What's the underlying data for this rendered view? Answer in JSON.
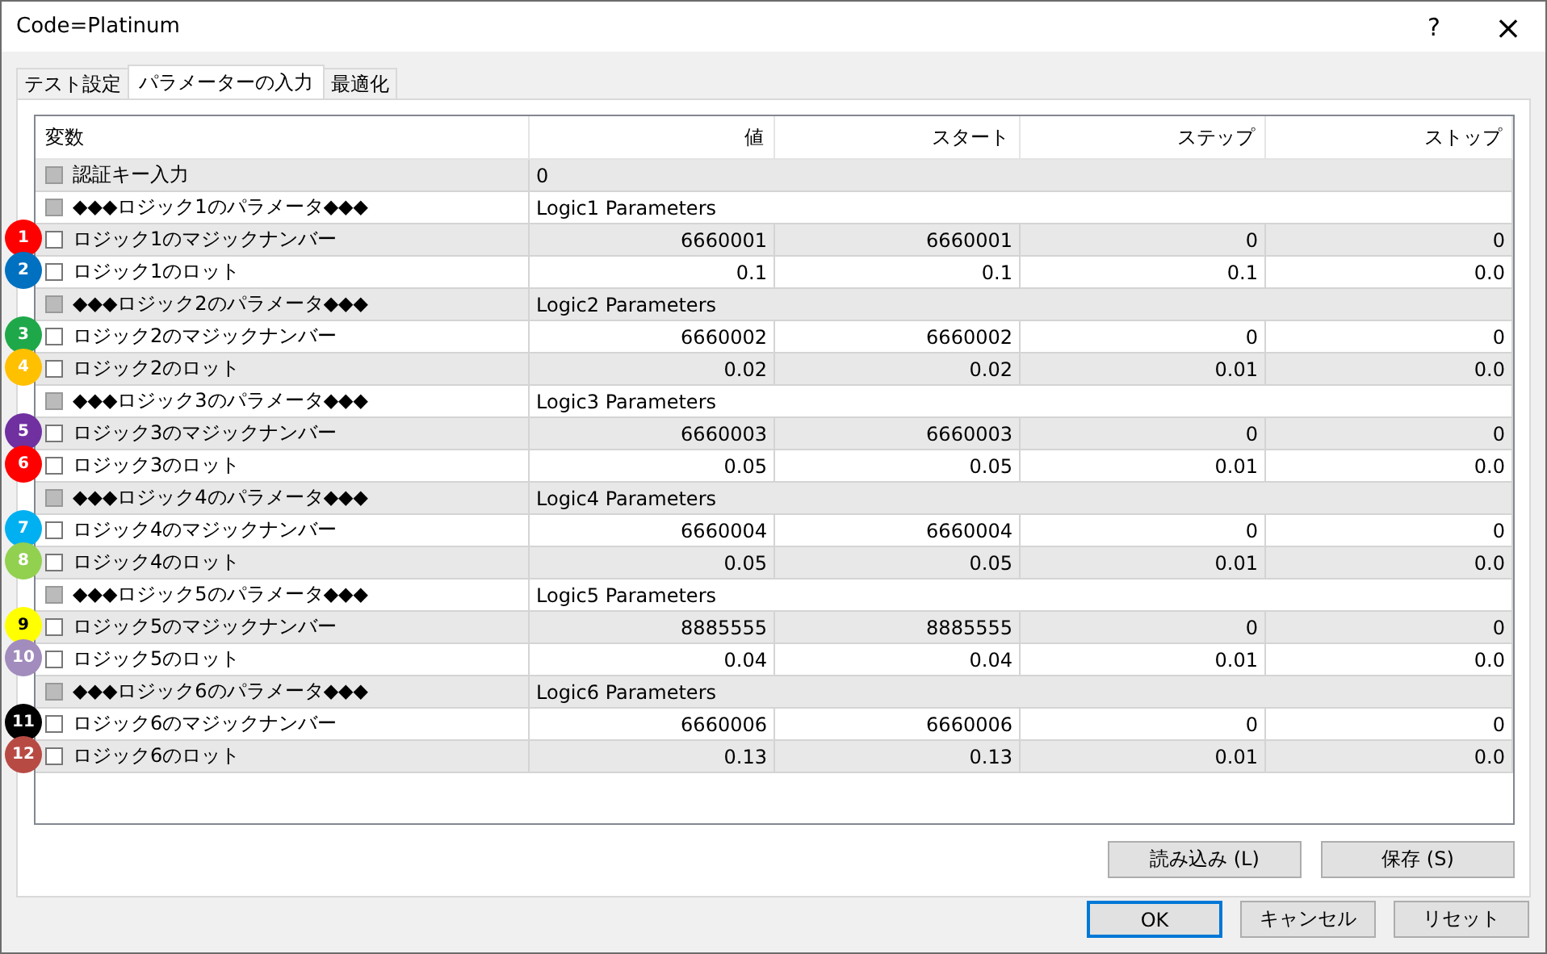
{
  "window": {
    "title": "Code=Platinum",
    "help": "?",
    "close": "×"
  },
  "tabs": [
    {
      "label": "テスト設定",
      "selected": false
    },
    {
      "label": "パラメーターの入力",
      "selected": true
    },
    {
      "label": "最適化",
      "selected": false
    }
  ],
  "table": {
    "columns": [
      "変数",
      "値",
      "スタート",
      "ステップ",
      "ストップ"
    ],
    "rows": [
      {
        "kind": "text",
        "name": "認証キー入力",
        "checked": false,
        "value": "0"
      },
      {
        "kind": "text",
        "name": "◆◆◆ロジック1のパラメータ◆◆◆",
        "checked": false,
        "value": "Logic1 Parameters"
      },
      {
        "kind": "number",
        "badge": "1",
        "color": "#ff0000",
        "name": "ロジック1のマジックナンバー",
        "checked": false,
        "value": "6660001",
        "start": "6660001",
        "step": "0",
        "stop": "0"
      },
      {
        "kind": "number",
        "badge": "2",
        "color": "#0070c0",
        "name": "ロジック1のロット",
        "checked": false,
        "value": "0.1",
        "start": "0.1",
        "step": "0.1",
        "stop": "0.0"
      },
      {
        "kind": "text",
        "name": "◆◆◆ロジック2のパラメータ◆◆◆",
        "checked": false,
        "value": "Logic2 Parameters"
      },
      {
        "kind": "number",
        "badge": "3",
        "color": "#1fa84a",
        "name": "ロジック2のマジックナンバー",
        "checked": false,
        "value": "6660002",
        "start": "6660002",
        "step": "0",
        "stop": "0"
      },
      {
        "kind": "number",
        "badge": "4",
        "color": "#ffc000",
        "name": "ロジック2のロット",
        "checked": false,
        "value": "0.02",
        "start": "0.02",
        "step": "0.01",
        "stop": "0.0"
      },
      {
        "kind": "text",
        "name": "◆◆◆ロジック3のパラメータ◆◆◆",
        "checked": false,
        "value": "Logic3 Parameters"
      },
      {
        "kind": "number",
        "badge": "5",
        "color": "#7030a0",
        "name": "ロジック3のマジックナンバー",
        "checked": false,
        "value": "6660003",
        "start": "6660003",
        "step": "0",
        "stop": "0"
      },
      {
        "kind": "number",
        "badge": "6",
        "color": "#ff0000",
        "name": "ロジック3のロット",
        "checked": false,
        "value": "0.05",
        "start": "0.05",
        "step": "0.01",
        "stop": "0.0"
      },
      {
        "kind": "text",
        "name": "◆◆◆ロジック4のパラメータ◆◆◆",
        "checked": false,
        "value": "Logic4 Parameters"
      },
      {
        "kind": "number",
        "badge": "7",
        "color": "#00b0f0",
        "name": "ロジック4のマジックナンバー",
        "checked": false,
        "value": "6660004",
        "start": "6660004",
        "step": "0",
        "stop": "0"
      },
      {
        "kind": "number",
        "badge": "8",
        "color": "#92d050",
        "name": "ロジック4のロット",
        "checked": false,
        "value": "0.05",
        "start": "0.05",
        "step": "0.01",
        "stop": "0.0"
      },
      {
        "kind": "text",
        "name": "◆◆◆ロジック5のパラメータ◆◆◆",
        "checked": false,
        "value": "Logic5 Parameters"
      },
      {
        "kind": "number",
        "badge": "9",
        "color": "#ffff00",
        "name": "ロジック5のマジックナンバー",
        "checked": false,
        "value": "8885555",
        "start": "8885555",
        "step": "0",
        "stop": "0"
      },
      {
        "kind": "number",
        "badge": "10",
        "color": "#a18cbd",
        "name": "ロジック5のロット",
        "checked": false,
        "value": "0.04",
        "start": "0.04",
        "step": "0.01",
        "stop": "0.0"
      },
      {
        "kind": "text",
        "name": "◆◆◆ロジック6のパラメータ◆◆◆",
        "checked": false,
        "value": "Logic6 Parameters"
      },
      {
        "kind": "number",
        "badge": "11",
        "color": "#000000",
        "name": "ロジック6のマジックナンバー",
        "checked": false,
        "value": "6660006",
        "start": "6660006",
        "step": "0",
        "stop": "0"
      },
      {
        "kind": "number",
        "badge": "12",
        "color": "#b84a44",
        "name": "ロジック6のロット",
        "checked": false,
        "value": "0.13",
        "start": "0.13",
        "step": "0.01",
        "stop": "0.0"
      }
    ]
  },
  "panel_buttons": [
    "読み込み (L)",
    "保存 (S)"
  ],
  "dialog_buttons": [
    {
      "label": "OK",
      "default": true
    },
    {
      "label": "キャンセル",
      "default": false
    },
    {
      "label": "リセット",
      "default": false
    }
  ]
}
